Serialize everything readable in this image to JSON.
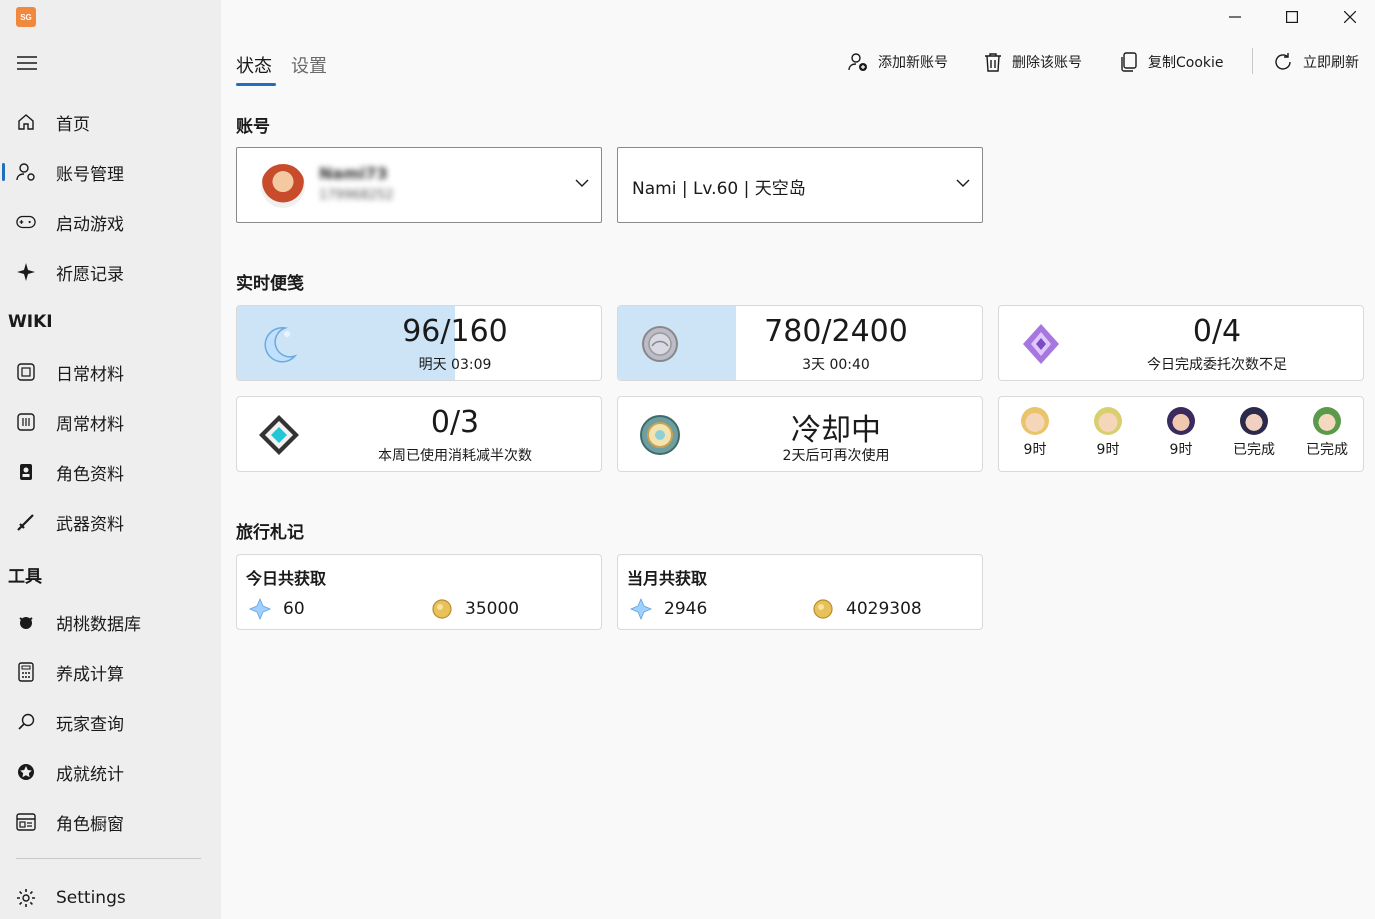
{
  "app": {
    "logo_text": "SG"
  },
  "sidebar": {
    "items": [
      {
        "label": "首页",
        "icon": "home-icon"
      },
      {
        "label": "账号管理",
        "icon": "account-settings-icon"
      },
      {
        "label": "启动游戏",
        "icon": "gamepad-icon"
      },
      {
        "label": "祈愿记录",
        "icon": "sparkle-icon"
      }
    ],
    "wiki_header": "WIKI",
    "wiki_items": [
      {
        "label": "日常材料",
        "icon": "daily-material-icon"
      },
      {
        "label": "周常材料",
        "icon": "weekly-material-icon"
      },
      {
        "label": "角色资料",
        "icon": "character-icon"
      },
      {
        "label": "武器资料",
        "icon": "weapon-icon"
      }
    ],
    "tools_header": "工具",
    "tool_items": [
      {
        "label": "胡桃数据库",
        "icon": "hutao-db-icon"
      },
      {
        "label": "养成计算",
        "icon": "calculator-icon"
      },
      {
        "label": "玩家查询",
        "icon": "search-icon"
      },
      {
        "label": "成就统计",
        "icon": "achievement-icon"
      },
      {
        "label": "角色橱窗",
        "icon": "showcase-icon"
      }
    ],
    "settings_label": "Settings"
  },
  "tabs": [
    "状态",
    "设置"
  ],
  "toolbar": {
    "add": "添加新账号",
    "delete": "删除该账号",
    "copy": "复制Cookie",
    "refresh": "立即刷新"
  },
  "account": {
    "header": "账号",
    "user_name": "Nami73",
    "user_uid": "179968252",
    "role_select": "Nami | Lv.60 | 天空岛"
  },
  "notes": {
    "header": "实时便笺",
    "resin": {
      "value": "96/160",
      "sub": "明天 03:09",
      "fraction": 0.6
    },
    "coin": {
      "value": "780/2400",
      "sub": "3天 00:40",
      "fraction": 0.325
    },
    "commission": {
      "value": "0/4",
      "sub": "今日完成委托次数不足"
    },
    "weekly": {
      "value": "0/3",
      "sub": "本周已使用消耗减半次数"
    },
    "transformer": {
      "value": "冷却中",
      "sub": "2天后可再次使用"
    },
    "expeditions": [
      "9时",
      "9时",
      "9时",
      "已完成",
      "已完成"
    ]
  },
  "ledger": {
    "header": "旅行札记",
    "today": {
      "title": "今日共获取",
      "primo": "60",
      "mora": "35000"
    },
    "month": {
      "title": "当月共获取",
      "primo": "2946",
      "mora": "4029308"
    }
  },
  "colors": {
    "accent": "#1f6fbf",
    "progress": "#cde4f7"
  }
}
